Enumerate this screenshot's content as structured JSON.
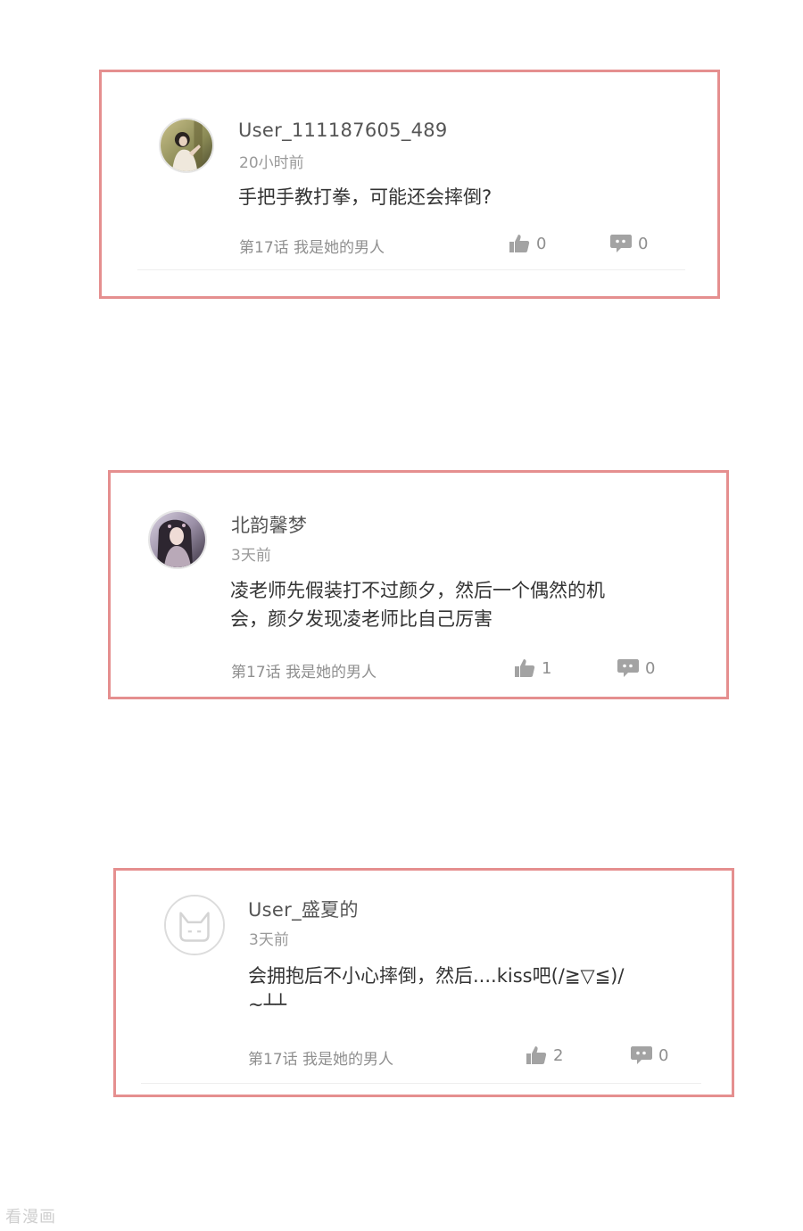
{
  "comments": [
    {
      "avatar_icon": "user-photo-avatar",
      "username": "User_111187605_489",
      "time": "20小时前",
      "content_lines": [
        "手把手教打拳，可能还会摔倒?"
      ],
      "chapter": "第17话 我是她的男人",
      "likes": "0",
      "replies": "0"
    },
    {
      "avatar_icon": "user-photo-avatar",
      "username": "北韵馨梦",
      "time": "3天前",
      "content_lines": [
        "凌老师先假装打不过颜夕，然后一个偶然的机",
        "会，颜夕发现凌老师比自己厉害"
      ],
      "chapter": "第17话 我是她的男人",
      "likes": "1",
      "replies": "0"
    },
    {
      "avatar_icon": "default-bunny-avatar",
      "username": "User_盛夏的",
      "time": "3天前",
      "content_lines": [
        "会拥抱后不小心摔倒，然后....kiss吧(/≧▽≦)/",
        "~┴┴"
      ],
      "chapter": "第17话 我是她的男人",
      "likes": "2",
      "replies": "0"
    }
  ],
  "icons": {
    "like": "thumbs-up-icon",
    "reply": "comment-bubble-icon"
  },
  "colors": {
    "card_border": "#e58f8f",
    "text_primary": "#333333",
    "text_secondary": "#9a9a9a"
  },
  "watermark": "看漫画"
}
